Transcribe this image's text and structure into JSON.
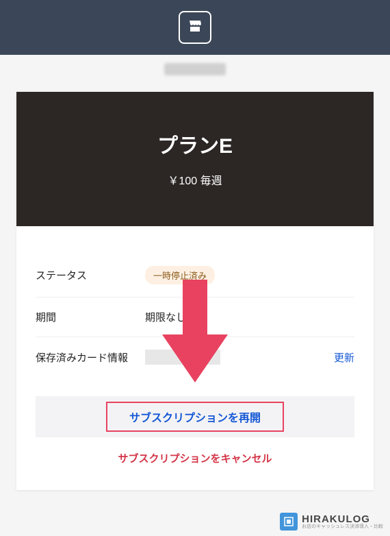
{
  "header": {
    "plan_name": "プランE",
    "plan_price": "￥100 毎週"
  },
  "status": {
    "label": "ステータス",
    "value": "一時停止済み"
  },
  "period": {
    "label": "期間",
    "value": "期限なし"
  },
  "card": {
    "label": "保存済みカード情報",
    "update": "更新"
  },
  "actions": {
    "resume": "サブスクリプションを再開",
    "cancel": "サブスクリプションをキャンセル"
  },
  "watermark": {
    "title": "HIRAKULOG",
    "sub": "お店のキャッシュレス決済導入・比較"
  }
}
